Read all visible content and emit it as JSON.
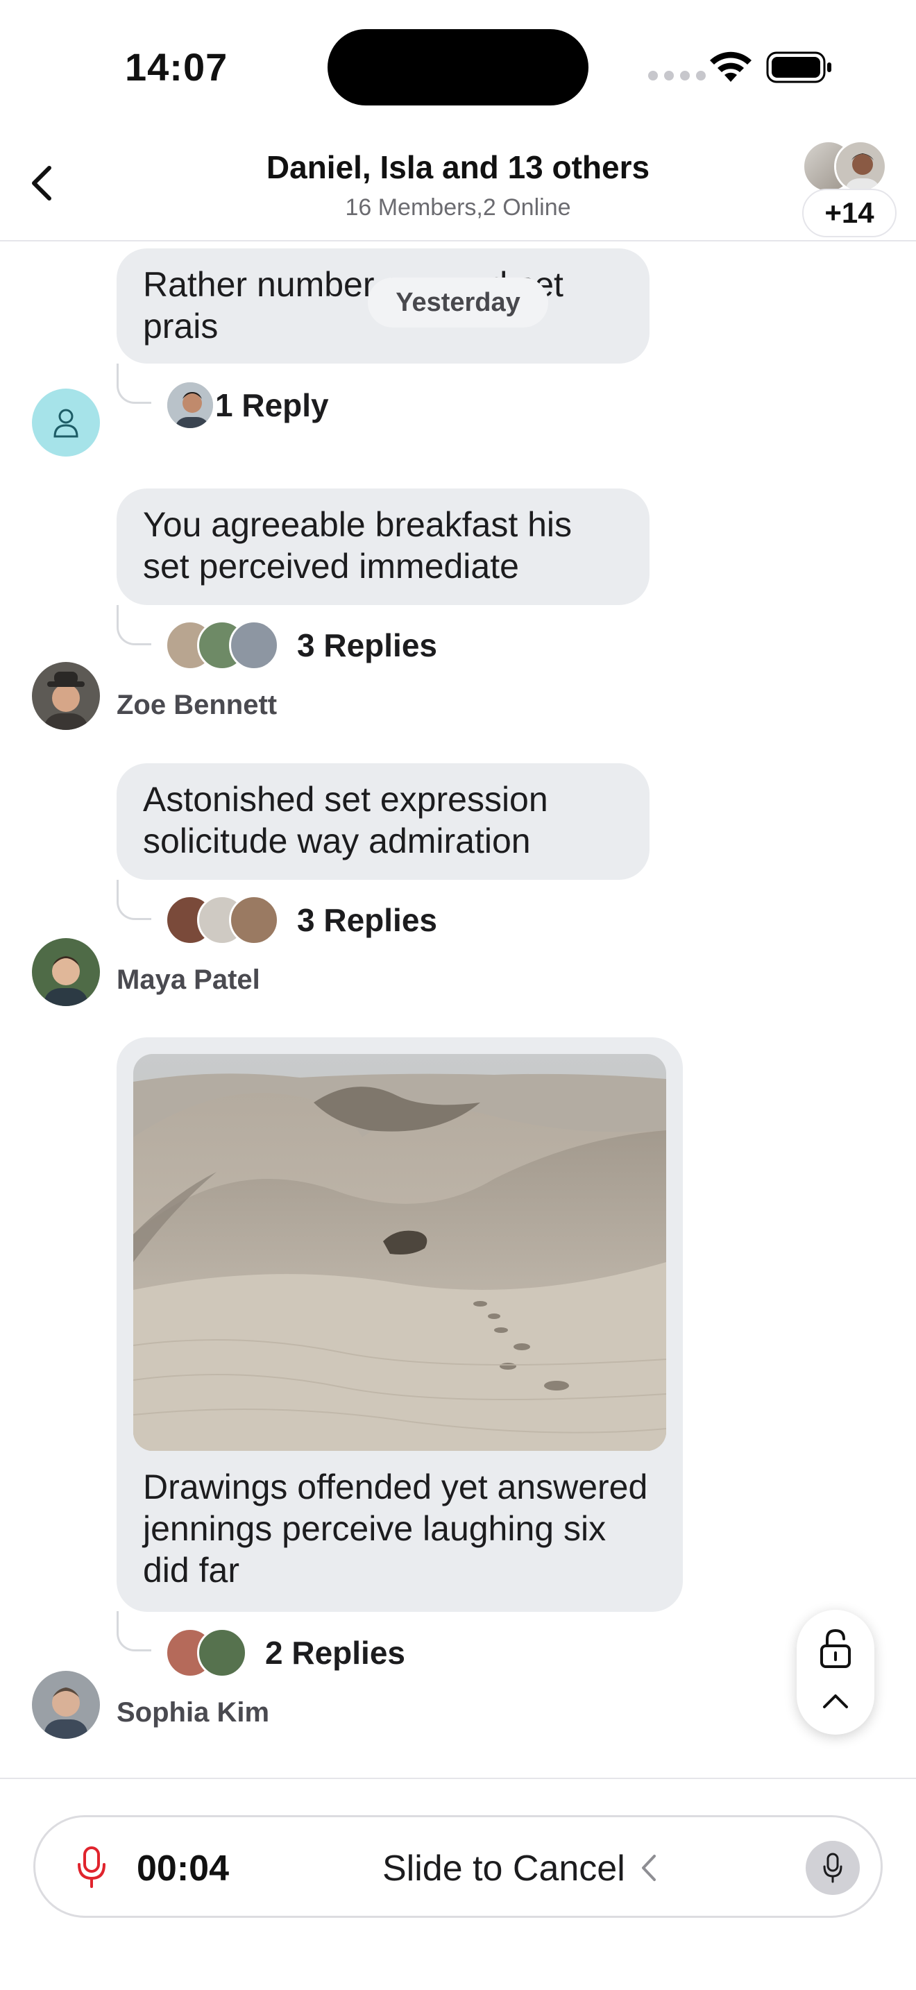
{
  "status_bar": {
    "time": "14:07",
    "icons": [
      "signal-icon",
      "wifi-icon",
      "battery-icon"
    ]
  },
  "header": {
    "title": "Daniel, Isla and 13 others",
    "subtitle": "16 Members,2 Online",
    "more_members": "+14"
  },
  "date_separator": "Yesterday",
  "messages": [
    {
      "text": "Rather number can and set prais",
      "reply_label": "1 Reply",
      "sender": ""
    },
    {
      "text": "You agreeable breakfast his set perceived immediate",
      "reply_label": "3 Replies",
      "sender": "Zoe Bennett"
    },
    {
      "text": "Astonished set expression solicitude way admiration",
      "reply_label": "3 Replies",
      "sender": "Maya Patel"
    },
    {
      "text": "Drawings offended yet answered jennings perceive laughing six did far",
      "reply_label": "2 Replies",
      "sender": "Sophia Kim",
      "has_image": true
    }
  ],
  "composer": {
    "recording_time": "00:04",
    "slide_to_cancel": "Slide to Cancel"
  },
  "colors": {
    "bubble": "#eaecef",
    "record_red": "#e0242d",
    "placeholder_avatar": "#a6e3e9"
  }
}
